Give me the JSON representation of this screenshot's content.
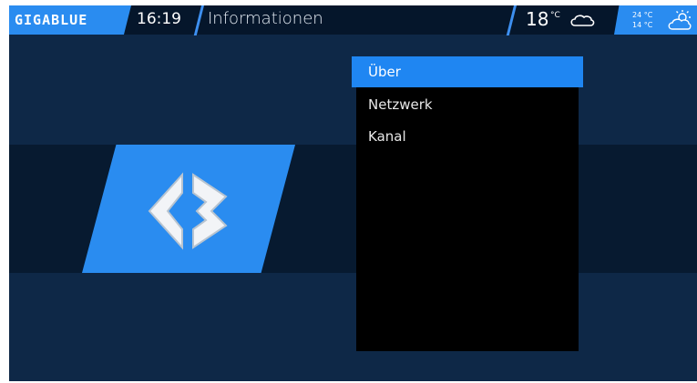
{
  "header": {
    "brand": "GIGABLUE",
    "time": "16:19",
    "title": "Informationen"
  },
  "weather": {
    "current_temp": "18",
    "unit": "°C",
    "current_icon": "cloud-icon",
    "high": "24 °C",
    "low": "14 °C",
    "forecast_icon": "partly-sunny-icon"
  },
  "menu": {
    "items": [
      {
        "label": "Über",
        "selected": true
      },
      {
        "label": "Netzwerk",
        "selected": false
      },
      {
        "label": "Kanal",
        "selected": false
      }
    ]
  },
  "colors": {
    "accent": "#2a8cf0",
    "background": "#0e2847",
    "band": "#071a30",
    "selection": "#1f86f2"
  }
}
